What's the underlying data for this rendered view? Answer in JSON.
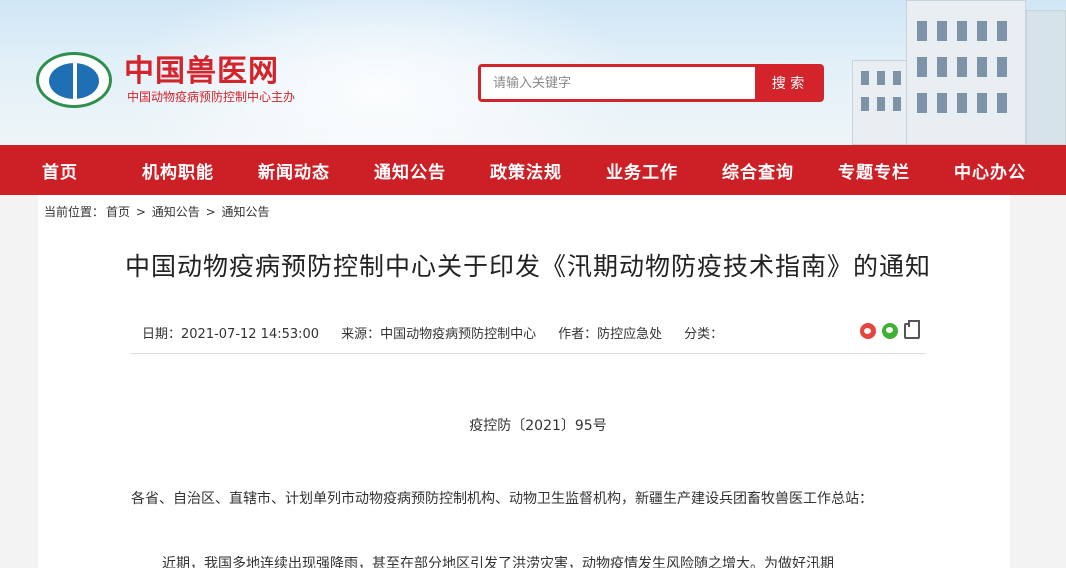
{
  "header": {
    "site_title": "中国兽医网",
    "site_subtitle": "中国动物疫病预防控制中心主办",
    "search_placeholder": "请输入关键字",
    "search_button": "搜 索"
  },
  "nav": {
    "items": [
      "首页",
      "机构职能",
      "新闻动态",
      "通知公告",
      "政策法规",
      "业务工作",
      "综合查询",
      "专题专栏",
      "中心办公"
    ]
  },
  "breadcrumb": {
    "label": "当前位置：",
    "items": [
      "首页",
      "通知公告",
      "通知公告"
    ],
    "separator": ">"
  },
  "article": {
    "title": "中国动物疫病预防控制中心关于印发《汛期动物防疫技术指南》的通知",
    "meta": {
      "date": "日期：2021-07-12 14:53:00",
      "source": "来源：中国动物疫病预防控制中心",
      "author": "作者：防控应急处",
      "category": "分类："
    },
    "share_icons": [
      "weibo-icon",
      "wechat-icon",
      "print-icon"
    ],
    "doc_number": "疫控防〔2021〕95号",
    "paragraph1": "各省、自治区、直辖市、计划单列市动物疫病预防控制机构、动物卫生监督机构，新疆生产建设兵团畜牧兽医工作总站：",
    "paragraph2": "近期，我国多地连续出现强降雨，甚至在部分地区引发了洪涝灾害，动物疫情发生风险随之增大。为做好汛期"
  },
  "colors": {
    "brand_red": "#cc1f26",
    "search_red": "#d3232b"
  }
}
